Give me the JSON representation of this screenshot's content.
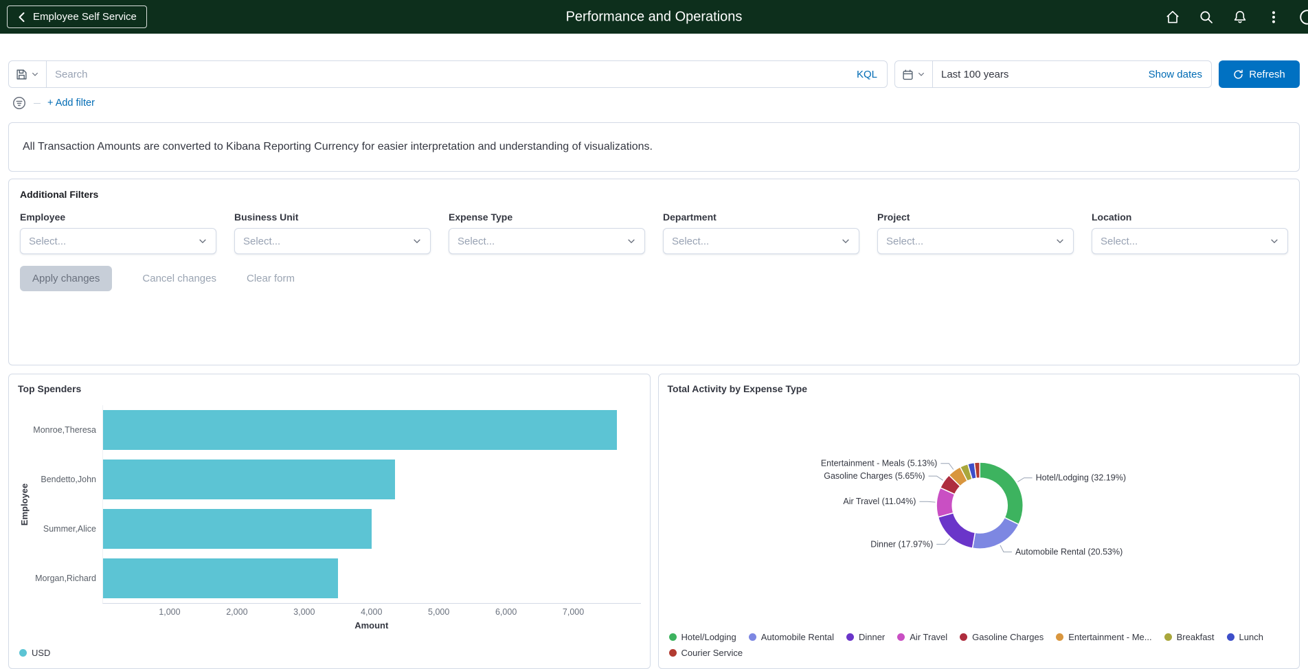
{
  "header": {
    "back_label": "Employee Self Service",
    "title": "Performance and Operations",
    "icons": [
      "chevron-left",
      "home",
      "search",
      "notifications",
      "kebab-menu",
      "brand-logo"
    ]
  },
  "query_bar": {
    "search_placeholder": "Search",
    "kql": "KQL",
    "date_range": "Last 100 years",
    "show_dates": "Show dates",
    "refresh": "Refresh",
    "icons": [
      "save-query",
      "chevron-down",
      "calendar",
      "chevron-down",
      "refresh"
    ],
    "accent_color": "#0071c2",
    "link_color": "#006bb4"
  },
  "filter_bar": {
    "add_filter": "+ Add filter",
    "icons": [
      "filter-circle"
    ]
  },
  "notice": {
    "text": "All Transaction Amounts are converted to Kibana Reporting Currency for easier interpretation and understanding of visualizations."
  },
  "filters_panel": {
    "title": "Additional Filters",
    "fields": [
      {
        "label": "Employee",
        "placeholder": "Select..."
      },
      {
        "label": "Business Unit",
        "placeholder": "Select..."
      },
      {
        "label": "Expense Type",
        "placeholder": "Select..."
      },
      {
        "label": "Department",
        "placeholder": "Select..."
      },
      {
        "label": "Project",
        "placeholder": "Select..."
      },
      {
        "label": "Location",
        "placeholder": "Select..."
      }
    ],
    "buttons": {
      "apply": "Apply changes",
      "cancel": "Cancel changes",
      "clear": "Clear form"
    }
  },
  "chart_data": [
    {
      "type": "bar",
      "orientation": "horizontal",
      "title": "Top Spenders",
      "categories": [
        "Monroe,Theresa",
        "Bendetto,John",
        "Summer,Alice",
        "Morgan,Richard"
      ],
      "values": [
        7650,
        4350,
        4000,
        3500
      ],
      "series_name": "USD",
      "color": "#5cc4d4",
      "xlabel": "Amount",
      "ylabel": "Employee",
      "xlim": [
        0,
        8000
      ],
      "xticks": [
        1000,
        2000,
        3000,
        4000,
        5000,
        6000,
        7000
      ],
      "grid": false,
      "legend_position": "bottom"
    },
    {
      "type": "pie",
      "donut": true,
      "title": "Total Activity by Expense Type",
      "label_min_pct": 5,
      "slices": [
        {
          "label": "Hotel/Lodging",
          "value": 32.19,
          "color": "#3db35f"
        },
        {
          "label": "Automobile Rental",
          "value": 20.53,
          "color": "#7d87e2"
        },
        {
          "label": "Dinner",
          "value": 17.97,
          "color": "#6a35c9"
        },
        {
          "label": "Air Travel",
          "value": 11.04,
          "color": "#c94fc3"
        },
        {
          "label": "Gasoline Charges",
          "value": 5.65,
          "color": "#ae2d3e"
        },
        {
          "label": "Entertainment - Meals",
          "value": 5.13,
          "color": "#d9963e",
          "legend_label": "Entertainment - Me..."
        },
        {
          "label": "Breakfast",
          "value": 3.0,
          "color": "#a9a73c"
        },
        {
          "label": "Lunch",
          "value": 2.5,
          "color": "#3d4ec9"
        },
        {
          "label": "Courier Service",
          "value": 1.99,
          "color": "#b23b31"
        }
      ],
      "legend_position": "bottom"
    }
  ]
}
